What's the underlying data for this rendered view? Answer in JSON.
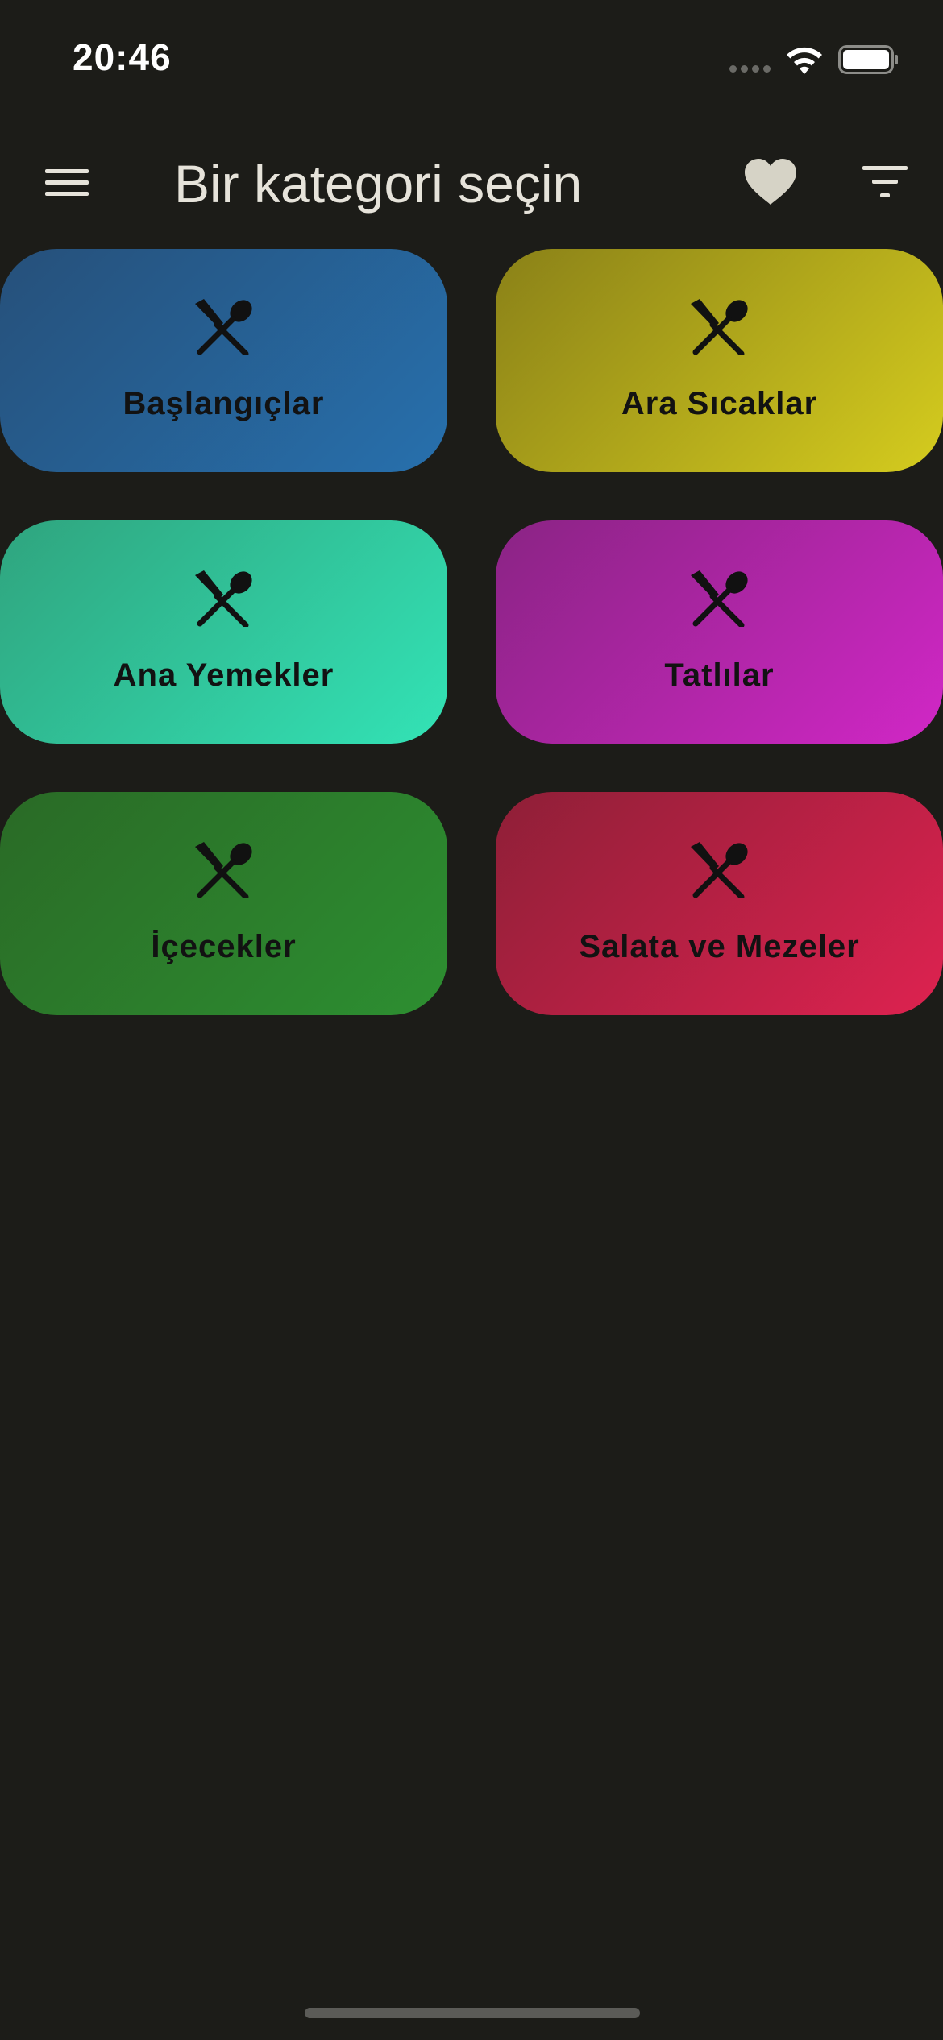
{
  "status_bar": {
    "time": "20:46"
  },
  "app_bar": {
    "title": "Bir kategori seçin",
    "icons": [
      "menu-icon",
      "heart-icon",
      "filter-icon"
    ]
  },
  "categories": [
    {
      "label": "Başlangıçlar",
      "icon": "fork-spoon-icon",
      "color_start": "#26507a",
      "color_end": "#2770ad"
    },
    {
      "label": "Ara Sıcaklar",
      "icon": "fork-spoon-icon",
      "color_start": "#8a8118",
      "color_end": "#d5cc1e"
    },
    {
      "label": "Ana Yemekler",
      "icon": "fork-spoon-icon",
      "color_start": "#2fa47e",
      "color_end": "#33e3b6"
    },
    {
      "label": "Tatlılar",
      "icon": "fork-spoon-icon",
      "color_start": "#8a2484",
      "color_end": "#d127c6"
    },
    {
      "label": "İçecekler",
      "icon": "fork-spoon-icon",
      "color_start": "#2a6a26",
      "color_end": "#2d8f31"
    },
    {
      "label": "Salata ve Mezeler",
      "icon": "fork-spoon-icon",
      "color_start": "#8e1f37",
      "color_end": "#de2250"
    }
  ]
}
